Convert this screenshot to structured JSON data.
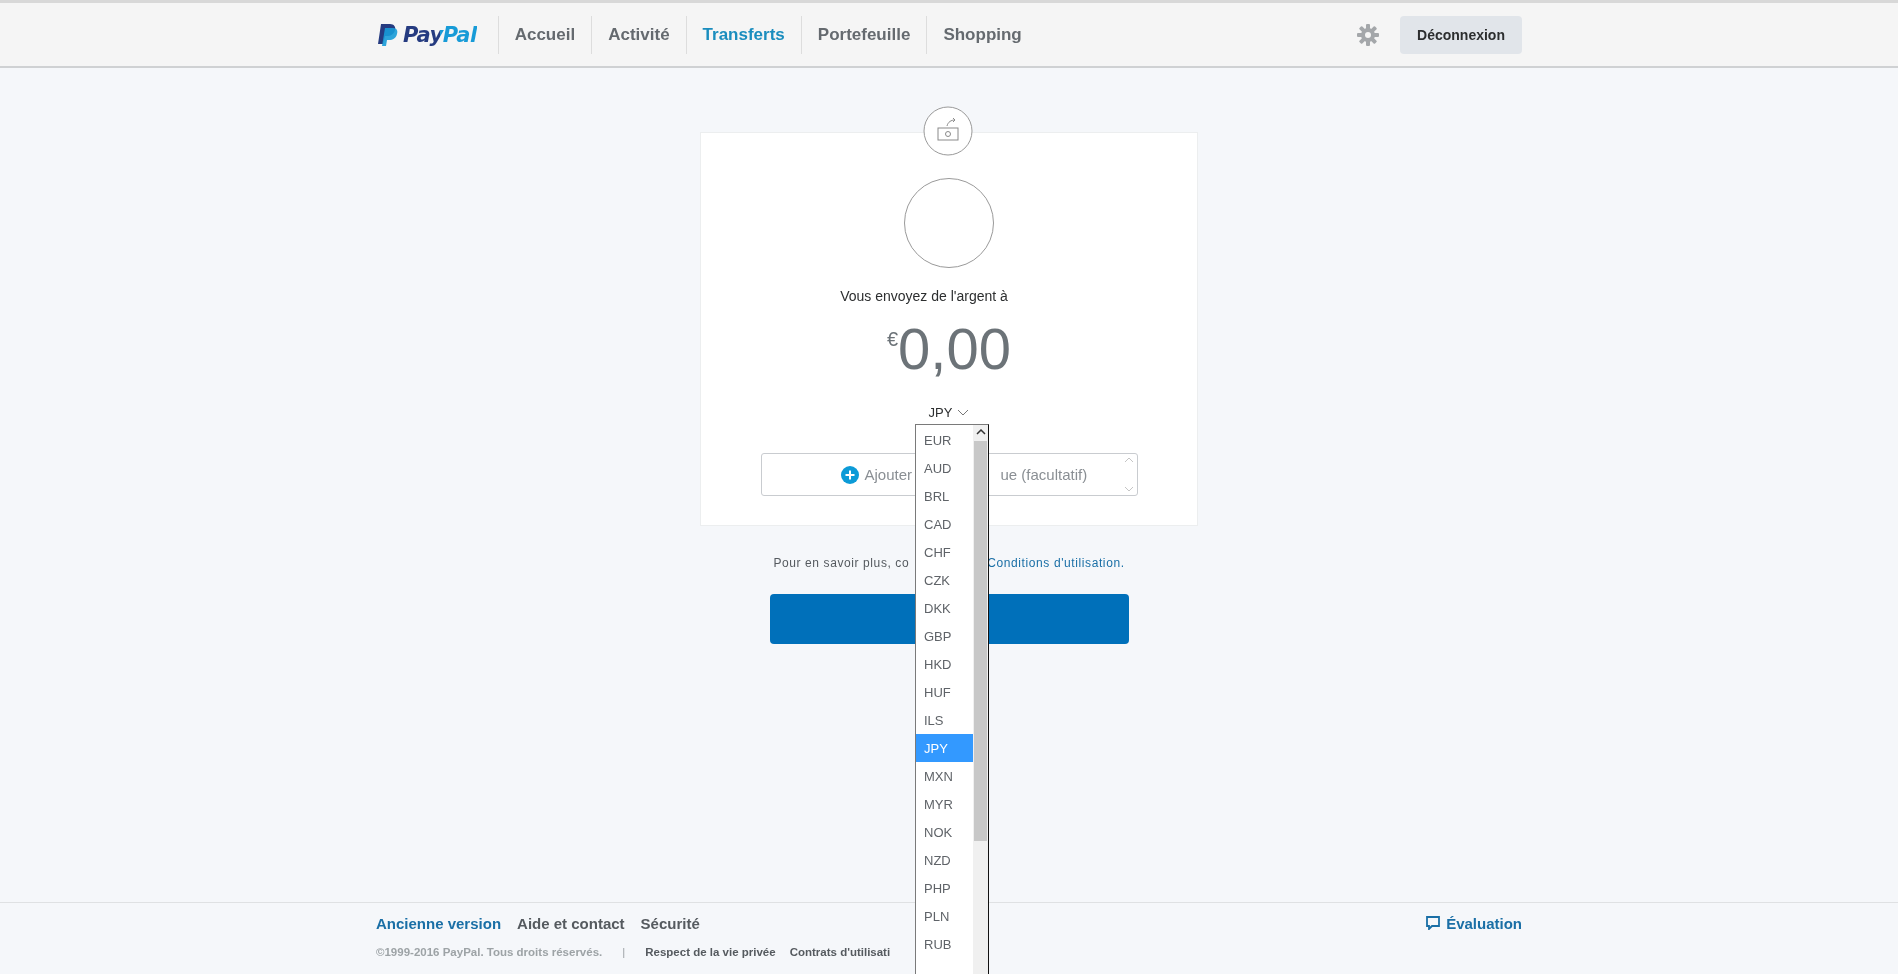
{
  "header": {
    "logo": "PayPal",
    "nav": [
      {
        "label": "Accueil",
        "selected": false
      },
      {
        "label": "Activité",
        "selected": false
      },
      {
        "label": "Transferts",
        "selected": true
      },
      {
        "label": "Portefeuille",
        "selected": false
      },
      {
        "label": "Shopping",
        "selected": false
      }
    ],
    "logout_button": "Déconnexion"
  },
  "payment": {
    "recipient_text": "Vous envoyez de l'argent à",
    "currency_symbol": "€",
    "amount": "0,00",
    "currency_select": {
      "value": "JPY",
      "expanded": true,
      "options": [
        {
          "label": "EUR",
          "selected": false
        },
        {
          "label": "AUD",
          "selected": false
        },
        {
          "label": "BRL",
          "selected": false
        },
        {
          "label": "CAD",
          "selected": false
        },
        {
          "label": "CHF",
          "selected": false
        },
        {
          "label": "CZK",
          "selected": false
        },
        {
          "label": "DKK",
          "selected": false
        },
        {
          "label": "GBP",
          "selected": false
        },
        {
          "label": "HKD",
          "selected": false
        },
        {
          "label": "HUF",
          "selected": false
        },
        {
          "label": "ILS",
          "selected": false
        },
        {
          "label": "JPY",
          "selected": true
        },
        {
          "label": "MXN",
          "selected": false
        },
        {
          "label": "MYR",
          "selected": false
        },
        {
          "label": "NOK",
          "selected": false
        },
        {
          "label": "NZD",
          "selected": false
        },
        {
          "label": "PHP",
          "selected": false
        },
        {
          "label": "PLN",
          "selected": false
        },
        {
          "label": "RUB",
          "selected": false
        }
      ]
    },
    "note_field": {
      "placeholder_parts": [
        "Ajouter",
        "ue (facultatif)"
      ]
    }
  },
  "terms": {
    "text": "Pour en savoir plus, co",
    "link": "Conditions d'utilisation."
  },
  "footer": {
    "links": [
      {
        "label": "Ancienne version",
        "kind": "primary"
      },
      {
        "label": "Aide et contact",
        "kind": "plain"
      },
      {
        "label": "Sécurité",
        "kind": "plain"
      }
    ],
    "feedback_link": "Évaluation",
    "copyright": "©1999-2016 PayPal. Tous droits réservés.",
    "separator": "|",
    "legal_links": [
      "Respect de la vie privée",
      "Contrats d'utilisati"
    ]
  }
}
